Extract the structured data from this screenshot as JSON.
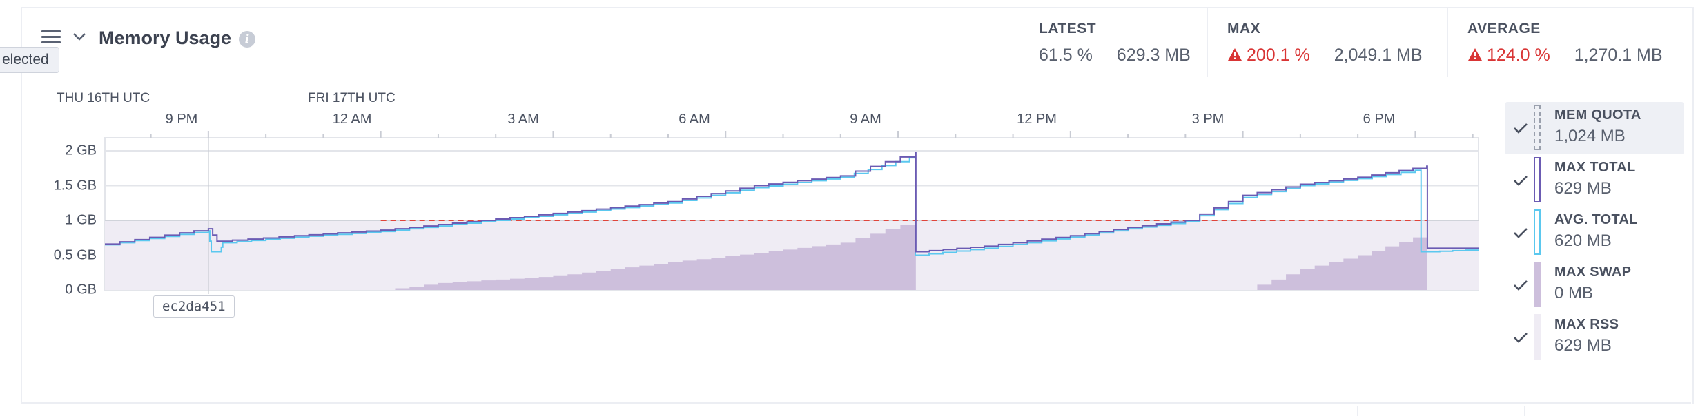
{
  "tooltip_left": "elected",
  "header": {
    "title": "Memory Usage",
    "info": "i"
  },
  "stats": {
    "latest": {
      "label": "LATEST",
      "percent": "61.5 %",
      "size": "629.3 MB"
    },
    "max": {
      "label": "MAX",
      "percent": "200.1 %",
      "size": "2,049.1 MB"
    },
    "average": {
      "label": "AVERAGE",
      "percent": "124.0 %",
      "size": "1,270.1 MB"
    }
  },
  "colors": {
    "max_total": "#6b5bb3",
    "avg_total": "#5bc8ef",
    "swap": "#cdbfdc",
    "rss": "#efecf4",
    "quota": "#e0443a",
    "warn": "#d93535"
  },
  "chart_data": {
    "type": "area",
    "time_zones": [
      "THU 16TH UTC",
      "FRI 17TH UTC"
    ],
    "x_ticks": [
      "9 PM",
      "12 AM",
      "3 AM",
      "6 AM",
      "9 AM",
      "12 PM",
      "3 PM",
      "6 PM"
    ],
    "y_ticks": [
      "2 GB",
      "1.5 GB",
      "1 GB",
      "0.5 GB",
      "0 GB"
    ],
    "ylim": [
      0,
      2.2
    ],
    "x_unit": "hours",
    "xlim": [
      19.2,
      43.1
    ],
    "quota_gb": 1.0,
    "cursor_hour": 21.0,
    "cursor_label": "ec2da451",
    "series": [
      {
        "name": "MAX TOTAL",
        "x": [
          19.2,
          20.5,
          21.0,
          21.15,
          22.5,
          24.0,
          26.0,
          27.5,
          29.0,
          30.5,
          32.0,
          33.3,
          33.31,
          34.5,
          36.0,
          37.0,
          38.0,
          39.0,
          40.0,
          41.0,
          42.2,
          42.21,
          43.1
        ],
        "values": [
          0.66,
          0.82,
          0.88,
          0.7,
          0.78,
          0.86,
          1.02,
          1.14,
          1.27,
          1.5,
          1.64,
          1.98,
          0.55,
          0.63,
          0.78,
          0.9,
          1.0,
          1.36,
          1.52,
          1.62,
          1.78,
          0.6,
          0.6
        ]
      },
      {
        "name": "AVG. TOTAL",
        "x": [
          19.2,
          20.5,
          21.0,
          21.05,
          21.2,
          21.25,
          22.5,
          24.0,
          26.0,
          27.5,
          29.0,
          30.5,
          32.0,
          33.2,
          33.3,
          34.5,
          36.0,
          37.0,
          38.0,
          39.0,
          40.0,
          41.0,
          42.0,
          42.1,
          42.2,
          43.1
        ],
        "values": [
          0.65,
          0.8,
          0.85,
          0.55,
          0.55,
          0.68,
          0.76,
          0.84,
          1.0,
          1.12,
          1.25,
          1.47,
          1.62,
          1.9,
          0.5,
          0.6,
          0.76,
          0.88,
          0.98,
          1.33,
          1.5,
          1.6,
          1.72,
          0.55,
          0.55,
          0.58
        ]
      },
      {
        "name": "MAX SWAP",
        "x": [
          24.0,
          25.0,
          27.0,
          29.0,
          30.5,
          32.0,
          33.3,
          33.31,
          39.0,
          40.0,
          41.0,
          42.2,
          42.21,
          43.1
        ],
        "values": [
          0.0,
          0.1,
          0.2,
          0.4,
          0.53,
          0.68,
          1.0,
          0.0,
          0.0,
          0.3,
          0.5,
          0.82,
          0.0,
          0.0
        ]
      },
      {
        "name": "MAX RSS",
        "x": [
          19.2,
          43.1
        ],
        "values": [
          1.0,
          1.0
        ]
      }
    ]
  },
  "legend": [
    {
      "name": "MEM QUOTA",
      "value": "1,024 MB",
      "selected": true
    },
    {
      "name": "MAX TOTAL",
      "value": "629 MB",
      "selected": false
    },
    {
      "name": "AVG. TOTAL",
      "value": "620 MB",
      "selected": false
    },
    {
      "name": "MAX SWAP",
      "value": "0 MB",
      "selected": false
    },
    {
      "name": "MAX RSS",
      "value": "629 MB",
      "selected": false
    }
  ]
}
